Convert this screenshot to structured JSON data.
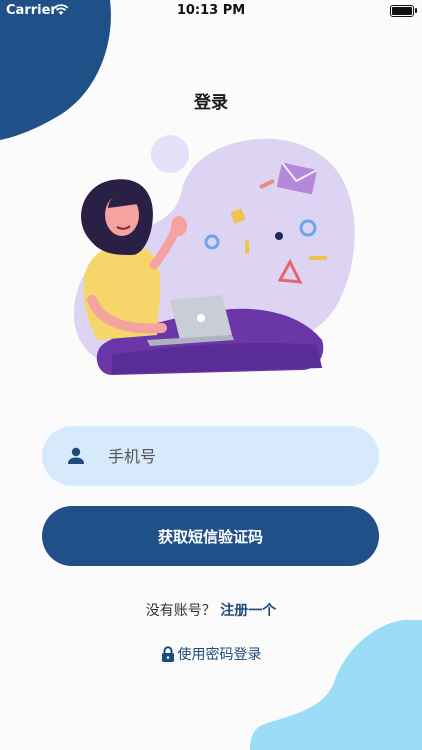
{
  "status_bar": {
    "carrier": "Carrier",
    "time": "10:13 PM"
  },
  "header": {
    "title": "登录"
  },
  "form": {
    "phone_placeholder": "手机号",
    "sms_button_label": "获取短信验证码"
  },
  "footer": {
    "no_account_text": "没有账号？",
    "register_link": "注册一个",
    "password_login_label": "使用密码登录"
  },
  "icons": {
    "user": "user-icon",
    "lock": "lock-icon",
    "wifi": "wifi-icon",
    "battery": "battery-icon"
  },
  "colors": {
    "primary": "#1f5088",
    "input_bg": "#d6eafc",
    "blob_top": "#1f5088",
    "blob_bottom": "#9bdcf6",
    "illustration_blob": "#dcd4f2"
  }
}
